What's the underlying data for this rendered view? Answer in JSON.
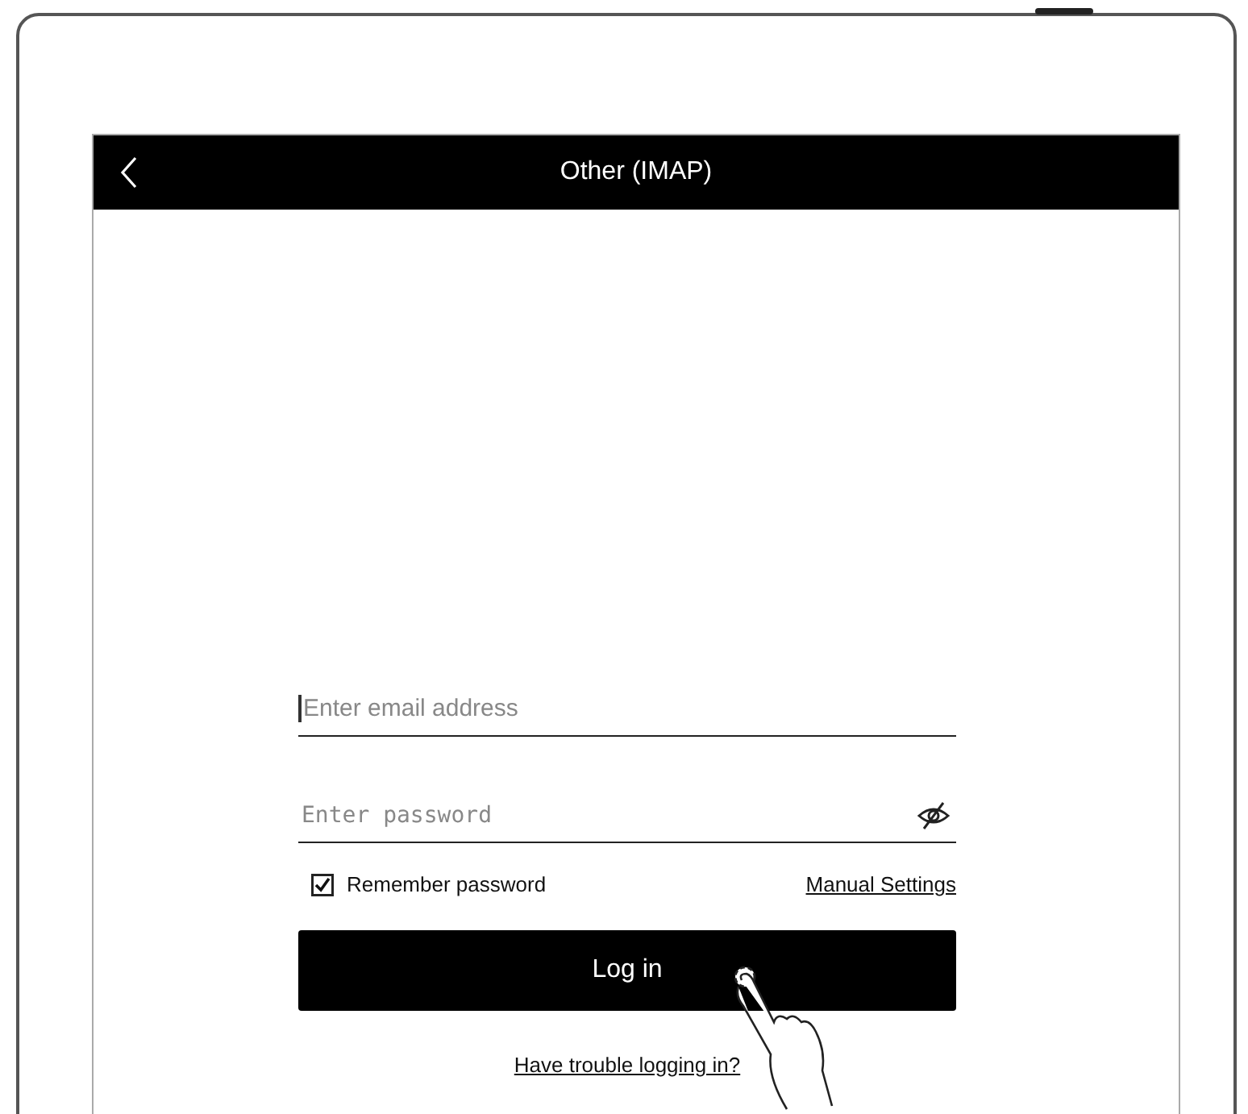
{
  "screen": {
    "title": "Other (IMAP)"
  },
  "email": {
    "placeholder": "Enter email address"
  },
  "password": {
    "placeholder": "Enter password"
  },
  "remember": {
    "label": "Remember password",
    "checked": true
  },
  "manual_settings": "Manual Settings",
  "login_button": "Log in",
  "trouble_link": "Have trouble logging in?"
}
